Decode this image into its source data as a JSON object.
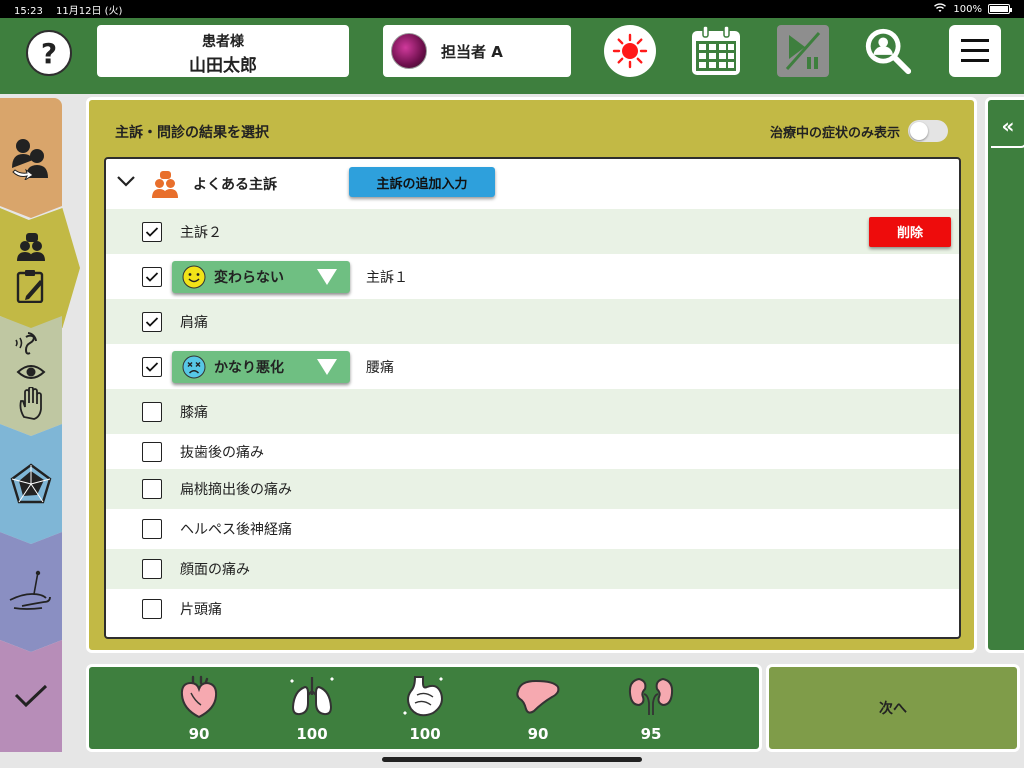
{
  "status_bar": {
    "time": "15:23",
    "date": "11月12日 (火)",
    "battery": "100%"
  },
  "header": {
    "help_label": "?",
    "patient_label": "患者様",
    "patient_name": "山田太郎",
    "staff_name": "担当者 A",
    "icons": [
      "help-icon",
      "sun-icon",
      "calendar-icon",
      "play-pause-icon",
      "user-search-icon",
      "hamburger-menu-icon"
    ]
  },
  "side_nav": {
    "items": [
      "patient-exchange-icon",
      "consultation-icon",
      "senses-icon",
      "pentagon-chart-icon",
      "acupuncture-icon",
      "checkmark-icon"
    ],
    "colors": [
      "#d9a56b",
      "#c2b945",
      "#bfc7a2",
      "#7fb6d6",
      "#8a8fc2",
      "#b78db8"
    ]
  },
  "panel": {
    "title": "主訴・問診の結果を選択",
    "filter_label": "治療中の症状のみ表示",
    "filter_on": false,
    "group_title": "よくある主訴",
    "add_button": "主訴の追加入力",
    "delete_button": "削除",
    "rows": [
      {
        "label": "主訴２",
        "checked": true,
        "status": null
      },
      {
        "label": "主訴１",
        "checked": true,
        "status": "変わらない",
        "status_face": "smile"
      },
      {
        "label": "肩痛",
        "checked": true,
        "status": null
      },
      {
        "label": "腰痛",
        "checked": true,
        "status": "かなり悪化",
        "status_face": "dizzy"
      },
      {
        "label": "膝痛",
        "checked": false,
        "status": null
      },
      {
        "label": "抜歯後の痛み",
        "checked": false,
        "status": null
      },
      {
        "label": "扁桃摘出後の痛み",
        "checked": false,
        "status": null
      },
      {
        "label": "ヘルペス後神経痛",
        "checked": false,
        "status": null
      },
      {
        "label": "顔面の痛み",
        "checked": false,
        "status": null
      },
      {
        "label": "片頭痛",
        "checked": false,
        "status": null
      }
    ]
  },
  "drawer": {
    "label": "«"
  },
  "vitals": [
    {
      "name": "heart-icon",
      "value": "90"
    },
    {
      "name": "lungs-icon",
      "value": "100"
    },
    {
      "name": "stomach-icon",
      "value": "100"
    },
    {
      "name": "liver-icon",
      "value": "90"
    },
    {
      "name": "kidneys-icon",
      "value": "95"
    }
  ],
  "footer": {
    "next_label": "次へ"
  },
  "colors": {
    "header_green": "#3e7f3e",
    "panel_olive": "#c2b945",
    "add_blue": "#2ea0dc",
    "delete_red": "#ee0c0c",
    "status_green": "#6fbf82"
  }
}
